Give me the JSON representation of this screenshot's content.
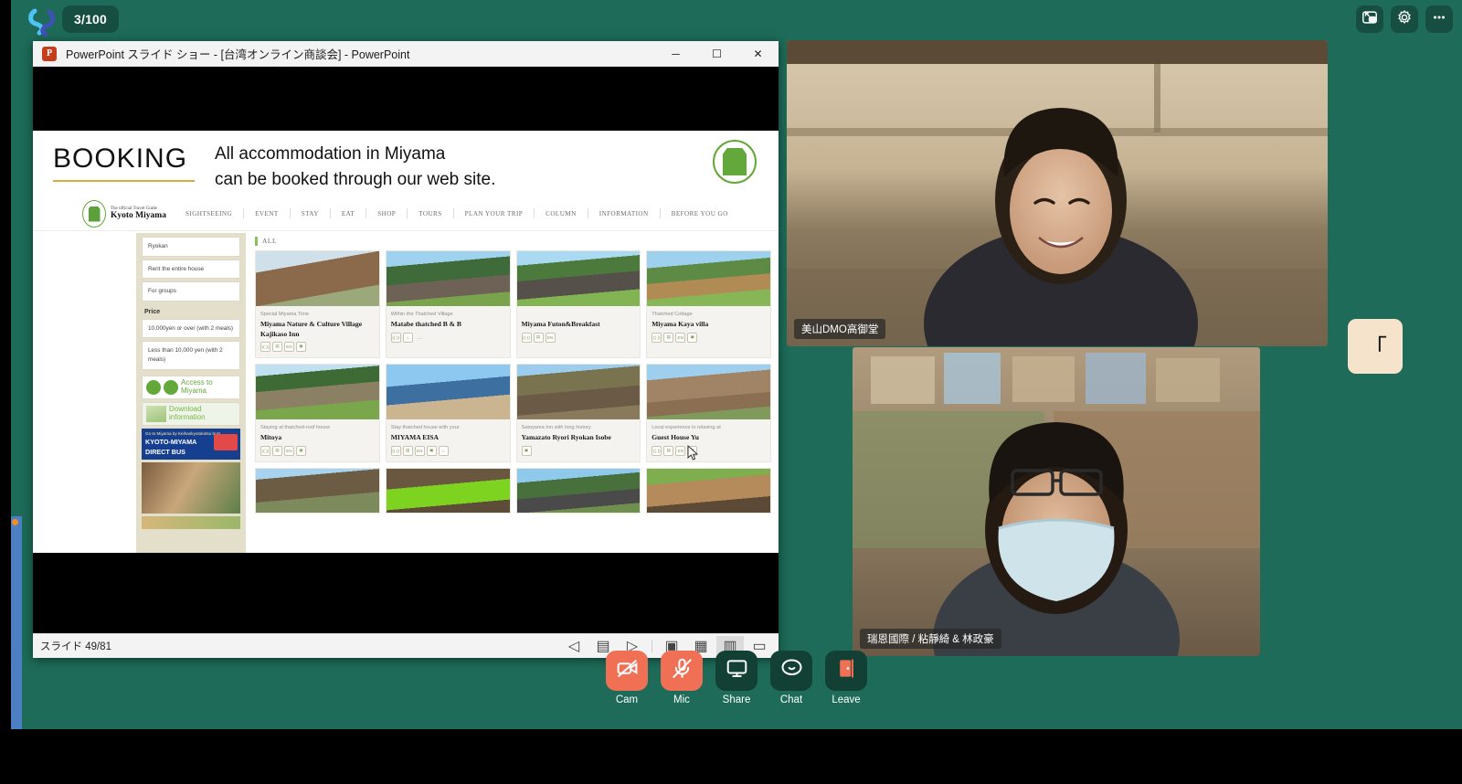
{
  "app": {
    "participant_badge": "3/100",
    "top_buttons": [
      {
        "name": "layout-view-button",
        "icon": "picture-in-picture-icon"
      },
      {
        "name": "settings-button",
        "icon": "gear-icon"
      },
      {
        "name": "more-options-button",
        "icon": "ellipsis-icon"
      }
    ]
  },
  "powerpoint": {
    "app_icon_letter": "P",
    "title": "PowerPoint スライド ショー - [台湾オンライン商談会] - PowerPoint",
    "window_buttons": {
      "minimize": "─",
      "maximize": "☐",
      "close": "✕"
    },
    "status": {
      "slide_counter": "スライド 49/81"
    },
    "statusbar_icons": [
      {
        "name": "previous-slide-icon",
        "glyph": "◁"
      },
      {
        "name": "notes-pane-icon",
        "glyph": "▤"
      },
      {
        "name": "next-slide-icon",
        "glyph": "▷"
      },
      {
        "name": "normal-view-icon",
        "glyph": "▣"
      },
      {
        "name": "slide-sorter-icon",
        "glyph": "▦"
      },
      {
        "name": "reading-view-icon",
        "glyph": "▥"
      },
      {
        "name": "slideshow-icon",
        "glyph": "▭"
      }
    ]
  },
  "slide": {
    "section_label": "BOOKING",
    "headline_line1": "All accommodation in Miyama",
    "headline_line2": "can be booked through our web site.",
    "website": {
      "logo_sub": "The official Travel Guide",
      "logo_main": "Kyoto Miyama",
      "menu": [
        "SIGHTSEEING",
        "EVENT",
        "STAY",
        "EAT",
        "SHOP",
        "TOURS",
        "PLAN YOUR TRIP",
        "COLUMN",
        "INFORMATION",
        "BEFORE YOU GO"
      ],
      "sidebar": {
        "filters": [
          "Ryokan",
          "Rent the entire house",
          "For groups"
        ],
        "price_heading": "Price",
        "price_filters": [
          "10,000yen or over (with 2 meals)",
          "Less than 10,000 yen (with 2 meals)"
        ],
        "banners": [
          {
            "name": "access-to-miyama-banner",
            "line1": "Access to",
            "line2": "Miyama"
          },
          {
            "name": "download-information-banner",
            "line1": "Download",
            "line2": "information"
          },
          {
            "name": "direct-bus-banner",
            "line1": "Go to Miyama by Keihankyotokotsu bus!",
            "line2": "KYOTO-MIYAMA",
            "line3": "DIRECT BUS"
          }
        ]
      },
      "results_label": "ALL",
      "cards": [
        {
          "kicker": "Special Miyama Time",
          "title": "Miyama Nature & Culture Village Kajikaso Inn",
          "amenities": [
            "wifi",
            "card",
            "EN",
            "bus"
          ],
          "photo": "ph1"
        },
        {
          "kicker": "Within the Thatched Village",
          "title": "Matabe thatched B & B",
          "amenities": [
            "wifi",
            "pet",
            "dots"
          ],
          "photo": "ph2"
        },
        {
          "kicker": "",
          "title": "Miyama Futon&Breakfast",
          "amenities": [
            "wifi",
            "card",
            "EN"
          ],
          "photo": "ph3"
        },
        {
          "kicker": "Thatched Cottage",
          "title": "Miyama Kaya villa",
          "amenities": [
            "wifi",
            "card",
            "EN",
            "bus"
          ],
          "photo": "ph4"
        },
        {
          "kicker": "Staying at thatched-roof house",
          "title": "Mitoya",
          "amenities": [
            "wifi",
            "card",
            "EN",
            "bus"
          ],
          "photo": "ph5"
        },
        {
          "kicker": "Stay thatched house with your",
          "title": "MIYAMA EISA",
          "amenities": [
            "wifi",
            "card",
            "EN",
            "bus",
            "pet"
          ],
          "photo": "ph6"
        },
        {
          "kicker": "Satoyama Inn with long history",
          "title": "Yamazato Ryori Ryokan Isobe",
          "amenities": [
            "bus"
          ],
          "photo": "ph7"
        },
        {
          "kicker": "Local experience in relaxing at",
          "title": "Guest House Yu",
          "amenities": [
            "wifi",
            "card",
            "EN",
            "bus"
          ],
          "photo": "ph8"
        },
        {
          "kicker": "",
          "title": "",
          "amenities": [],
          "photo": "ph9"
        },
        {
          "kicker": "",
          "title": "",
          "amenities": [],
          "photo": "ph10"
        },
        {
          "kicker": "",
          "title": "",
          "amenities": [],
          "photo": "ph11"
        },
        {
          "kicker": "",
          "title": "",
          "amenities": [],
          "photo": "ph12"
        }
      ]
    }
  },
  "video_tiles": [
    {
      "name": "video-tile-presenter",
      "label": "美山DMO高御堂"
    },
    {
      "name": "video-tile-participant",
      "label": "瑞恩國際 / 粘靜綺 & 林政豪"
    }
  ],
  "side_tile": {
    "name": "participant-avatar-tile",
    "glyph": "「"
  },
  "controls": [
    {
      "name": "cam-button",
      "label": "Cam",
      "icon": "camera-off-icon",
      "state": "muted"
    },
    {
      "name": "mic-button",
      "label": "Mic",
      "icon": "mic-off-icon",
      "state": "muted"
    },
    {
      "name": "share-button",
      "label": "Share",
      "icon": "screen-share-icon",
      "state": "normal"
    },
    {
      "name": "chat-button",
      "label": "Chat",
      "icon": "chat-bubble-icon",
      "state": "normal"
    },
    {
      "name": "leave-button",
      "label": "Leave",
      "icon": "leave-door-icon",
      "state": "normal"
    }
  ],
  "colors": {
    "app_bg": "#1d6b58",
    "button_dark": "#134034",
    "muted": "#ef7055",
    "accent_green": "#63a83b"
  }
}
